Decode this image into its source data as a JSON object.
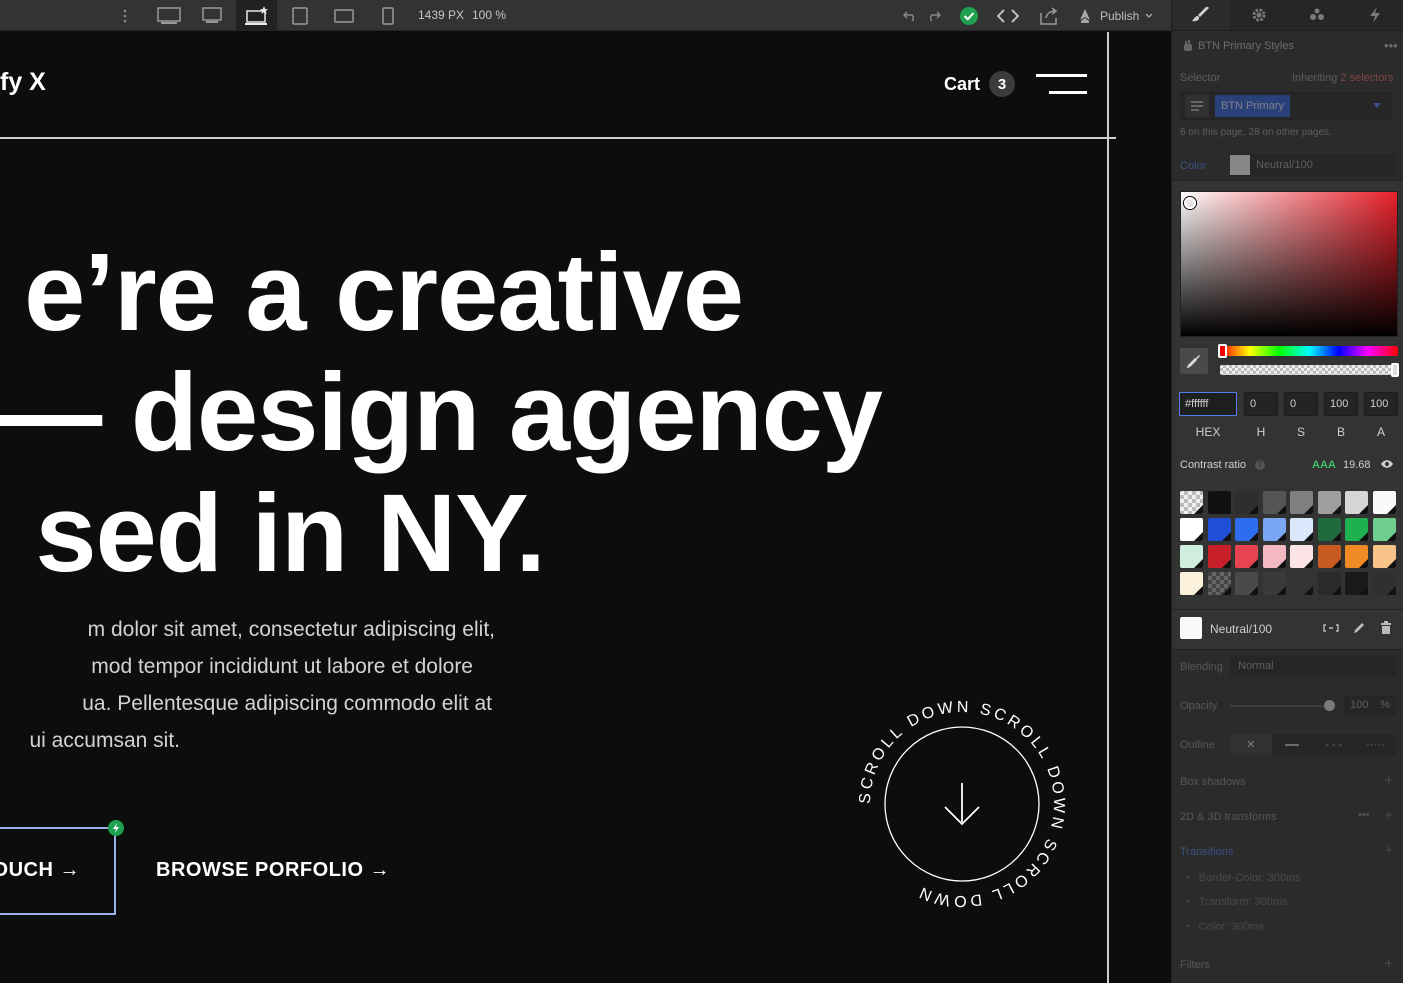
{
  "toolbar": {
    "width_px": "1439 PX",
    "zoom": "100 %",
    "publish_label": "Publish"
  },
  "canvas": {
    "brand": "fy X",
    "cart_label": "Cart",
    "cart_count": "3",
    "headline": [
      "e’re a creative",
      "— design agency",
      "sed in NY."
    ],
    "paragraph": [
      "m dolor sit amet, consectetur adipiscing elit,",
      "mod tempor incididunt ut labore et dolore",
      "ua. Pellentesque adipiscing commodo elit at",
      "ui accumsan sit."
    ],
    "cta_primary": "OUCH →",
    "cta_secondary": "BROWSE PORFOLIO →",
    "scroll_text": "SCROLL DOWN SCROLL DOWN SCROLL DOWN"
  },
  "panel": {
    "style_title": "BTN Primary Styles",
    "selector_label": "Selector",
    "inheriting_label": "Inheriting",
    "inheriting_count": "2 selectors",
    "selector_chip": "BTN Primary",
    "usage_note": "6 on this page, 28 on other pages.",
    "color_label": "Color",
    "color_value": "Neutral/100",
    "hex": "#ffffff",
    "h": "0",
    "s": "0",
    "b": "100",
    "a": "100",
    "labels": {
      "hex": "HEX",
      "h": "H",
      "s": "S",
      "b": "B",
      "a": "A"
    },
    "contrast_label": "Contrast ratio",
    "contrast_rating": "AAA",
    "contrast_value": "19.68",
    "selected_swatch_name": "Neutral/100",
    "blending_label": "Blending",
    "blending_value": "Normal",
    "opacity_label": "Opacity",
    "opacity_value": "100",
    "opacity_unit": "%",
    "outline_label": "Outline",
    "box_shadows_label": "Box shadows",
    "transforms_label": "2D & 3D transforms",
    "transitions_label": "Transitions",
    "transitions": [
      "Border-Color: 300ms",
      "Transform: 300ms",
      "Color: 300ms"
    ],
    "filters_label": "Filters"
  },
  "colors": {
    "accent_blue": "#2a5bd7",
    "success_green": "#1fa050",
    "contrast_green": "#3fbf6a",
    "inherit_red": "#c4483f"
  },
  "swatches": [
    [
      "checker",
      "#111111",
      "#2e2e2e",
      "#555555",
      "#7f7f7f",
      "#9e9e9e",
      "#d6d6d6",
      "#fafafa"
    ],
    [
      "#ffffff",
      "#1f4fd6",
      "#2e6cf0",
      "#7aa6f5",
      "#dbe7fb",
      "#1f6b3d",
      "#1fb050",
      "#6fcf8f"
    ],
    [
      "#cfeedd",
      "#c8202a",
      "#e8444f",
      "#f3b8c0",
      "#fbe3e6",
      "#c75a1e",
      "#f08a24",
      "#f8c48a"
    ],
    [
      "#fbf0dc",
      "checker-dark",
      "#4a4a4a",
      "#3a3a3a",
      "#333333",
      "#2a2a2a",
      "#1a1a1a",
      "#303030"
    ]
  ]
}
